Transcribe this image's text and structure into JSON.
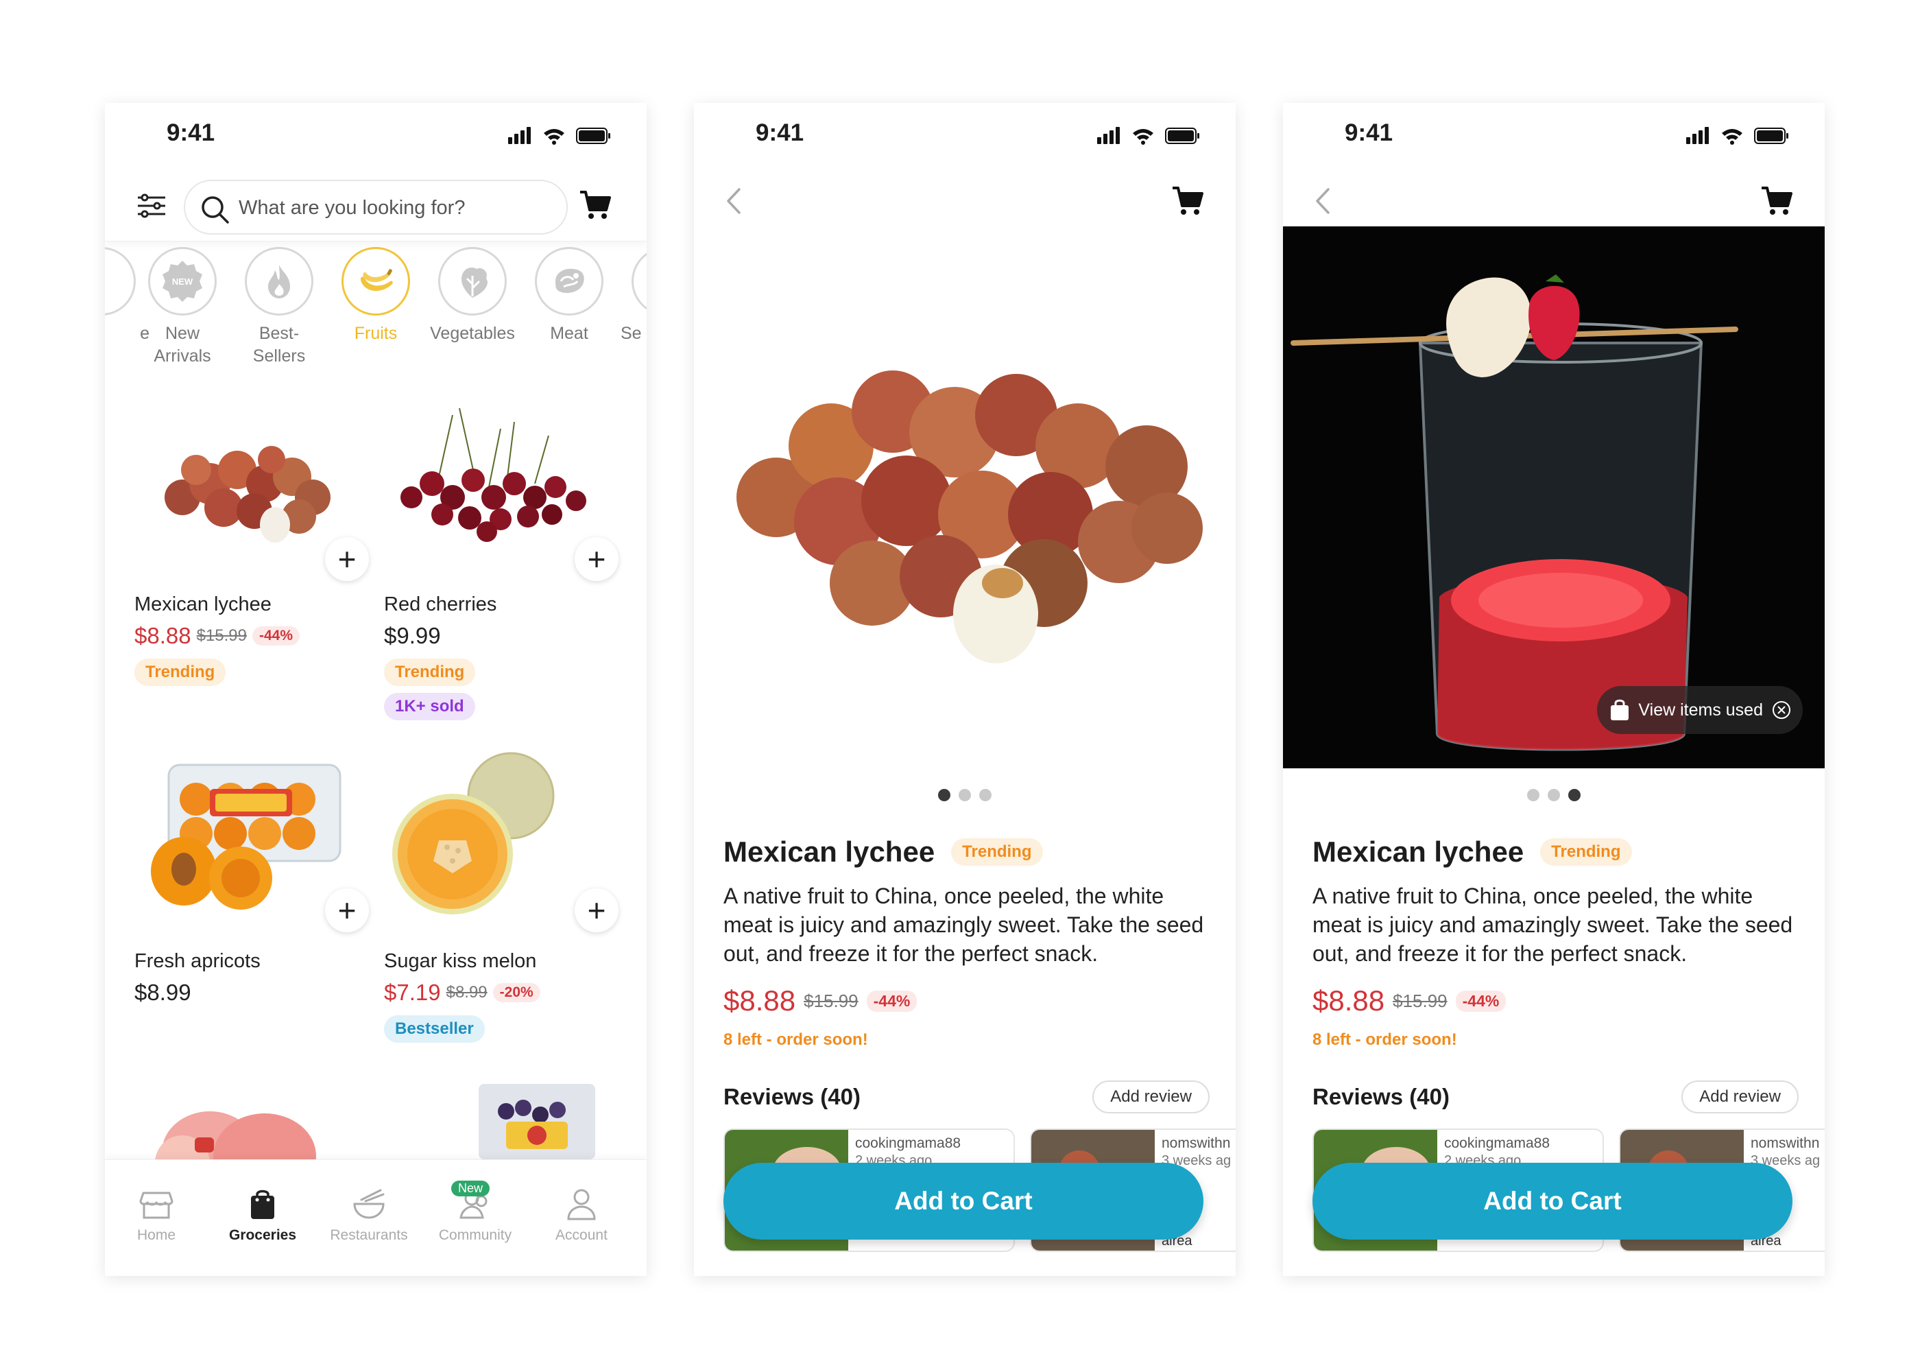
{
  "status": {
    "time": "9:41"
  },
  "home": {
    "search_placeholder": "What are you looking for?",
    "categories": [
      {
        "label": "New\nArrivals",
        "icon": "new-badge-icon"
      },
      {
        "label": "Best-\nSellers",
        "icon": "flame-icon"
      },
      {
        "label": "Fruits",
        "icon": "banana-icon"
      },
      {
        "label": "Vegetables",
        "icon": "vegetable-icon"
      },
      {
        "label": "Meat",
        "icon": "meat-icon"
      }
    ],
    "cat_partial_left": "e",
    "cat_partial_right": "Se",
    "products": [
      {
        "name": "Mexican lychee",
        "price": "$8.88",
        "old_price": "$15.99",
        "discount": "-44%",
        "badges": [
          "Trending"
        ]
      },
      {
        "name": "Red cherries",
        "price": "$9.99",
        "old_price": "",
        "discount": "",
        "badges": [
          "Trending",
          "1K+ sold"
        ]
      },
      {
        "name": "Fresh apricots",
        "price": "$8.99",
        "old_price": "",
        "discount": "",
        "badges": []
      },
      {
        "name": "Sugar kiss melon",
        "price": "$7.19",
        "old_price": "$8.99",
        "discount": "-20%",
        "badges": [
          "Bestseller"
        ]
      }
    ],
    "nav": {
      "home": "Home",
      "groceries": "Groceries",
      "restaurants": "Restaurants",
      "community": "Community",
      "community_new": "New",
      "account": "Account"
    }
  },
  "detail": {
    "title": "Mexican lychee",
    "badge": "Trending",
    "description": "A native fruit to China, once peeled, the white meat is juicy and amazingly sweet. Take the seed out, and freeze it for the perfect snack.",
    "price": "$8.88",
    "old_price": "$15.99",
    "discount": "-44%",
    "stock": "8 left - order soon!",
    "reviews_heading": "Reviews (40)",
    "add_review": "Add review",
    "reviews": [
      {
        "user": "cookingmama88",
        "when": "2 weeks ago",
        "text": ""
      },
      {
        "user": "nomswithn",
        "when": "3 weeks ag",
        "text": "chees\nnd w\nught\nalrea"
      }
    ],
    "cta": "Add to Cart",
    "view_items": "View items used",
    "carousel_count": 3
  },
  "colors": {
    "accent": "#1aa4c8",
    "sale": "#d13438",
    "trending": "#f08c1e",
    "active_cat": "#f2c43a"
  }
}
